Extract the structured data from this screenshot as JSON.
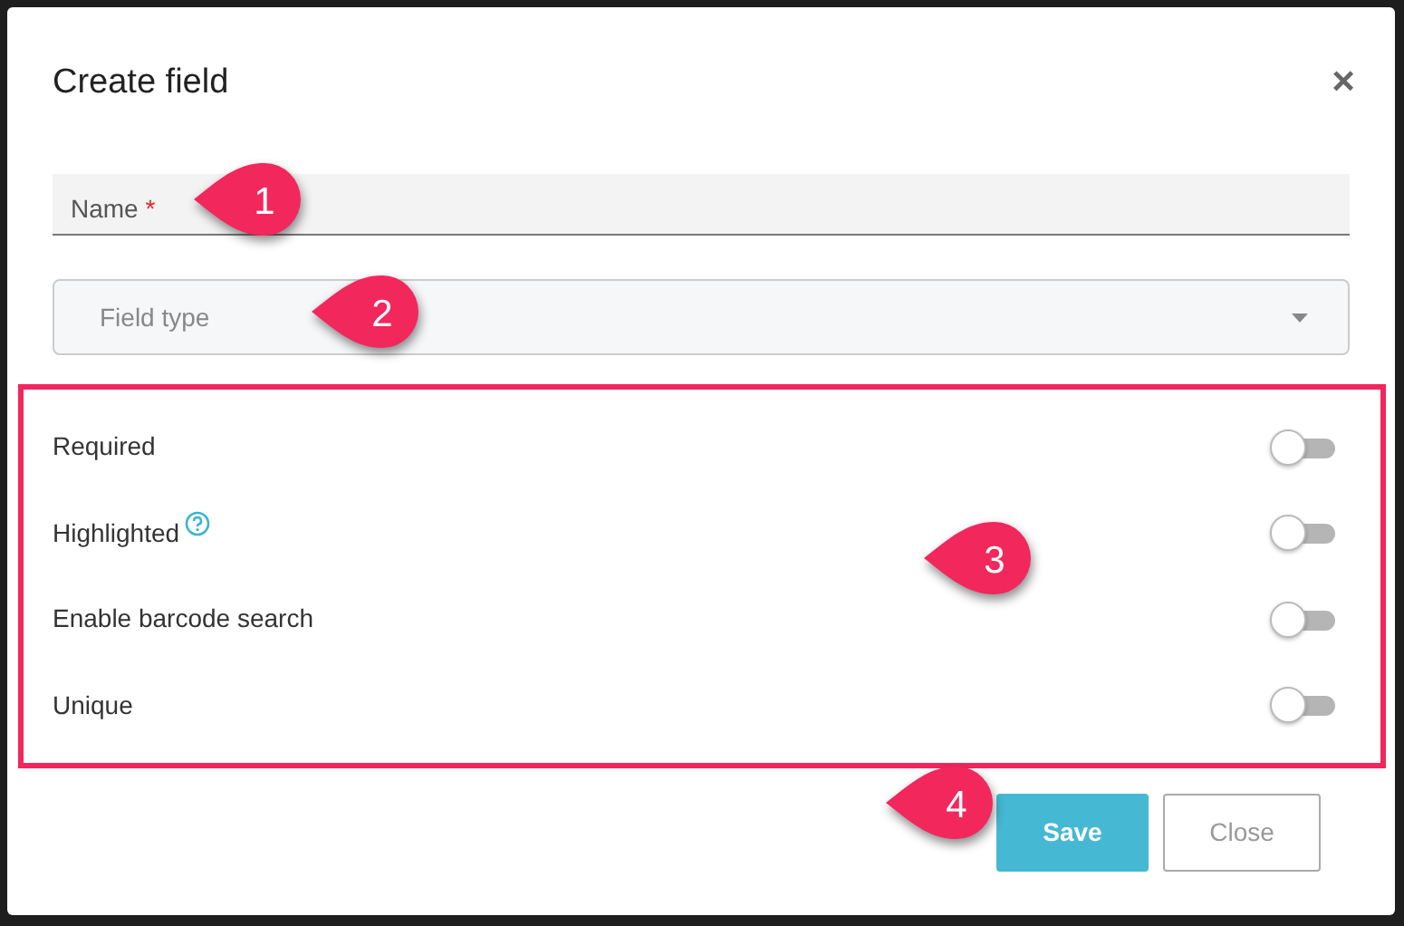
{
  "dialog": {
    "title": "Create field",
    "close_symbol": "×"
  },
  "name_field": {
    "placeholder": "Name",
    "required_mark": "*"
  },
  "field_type": {
    "placeholder": "Field type"
  },
  "options": [
    {
      "label": "Required",
      "help": false,
      "on": false
    },
    {
      "label": "Highlighted",
      "help": true,
      "on": false
    },
    {
      "label": "Enable barcode search",
      "help": false,
      "on": false
    },
    {
      "label": "Unique",
      "help": false,
      "on": false
    }
  ],
  "buttons": [
    {
      "label": "Save",
      "kind": "primary"
    },
    {
      "label": "Close",
      "kind": "secondary"
    }
  ],
  "callouts": [
    {
      "number": "1"
    },
    {
      "number": "2"
    },
    {
      "number": "3"
    },
    {
      "number": "4"
    }
  ]
}
